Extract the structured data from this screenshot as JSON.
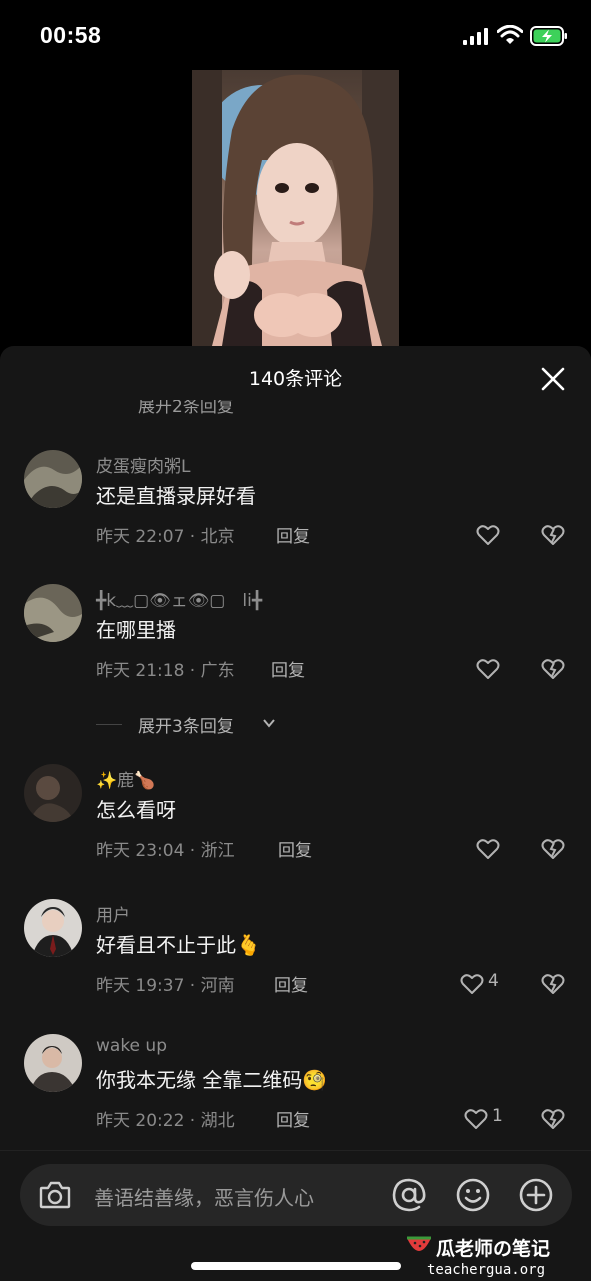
{
  "status_bar": {
    "time": "00:58"
  },
  "sheet": {
    "title": "140条评论",
    "peek_text": "展开2条回复"
  },
  "comments": [
    {
      "username": "皮蛋瘦肉粥L",
      "text": "还是直播录屏好看",
      "meta": "昨天 22:07 · 北京",
      "reply": "回复",
      "likes": ""
    },
    {
      "username": "╋k﹏▢👁ェ👁▢　li╋",
      "text": "在哪里播",
      "meta": "昨天 21:18 · 广东",
      "reply": "回复",
      "likes": ""
    },
    {
      "username": "✨鹿🍗",
      "text": "怎么看呀",
      "meta": "昨天 23:04 · 浙江",
      "reply": "回复",
      "likes": ""
    },
    {
      "username": "用户",
      "text": "好看且不止于此🫰",
      "meta": "昨天 19:37 · 河南",
      "reply": "回复",
      "likes": "4"
    },
    {
      "username": "wake up",
      "text": "你我本无缘 全靠二维码🧐",
      "meta": "昨天 20:22 · 湖北",
      "reply": "回复",
      "likes": "1"
    }
  ],
  "expand_replies": "展开3条回复",
  "input": {
    "placeholder": "善语结善缘，恶言伤人心"
  },
  "watermark": {
    "title": "瓜老师の笔记",
    "url": "teachergua.org"
  },
  "icons": [
    "signal-icon",
    "wifi-icon",
    "battery-charging-icon",
    "close-icon",
    "like-icon",
    "dislike-icon",
    "camera-icon",
    "at-icon",
    "emoji-icon",
    "plus-icon"
  ],
  "colors": {
    "sheet_bg": "#161616",
    "input_bg": "#262626",
    "muted_text": "#8a8a8a"
  }
}
